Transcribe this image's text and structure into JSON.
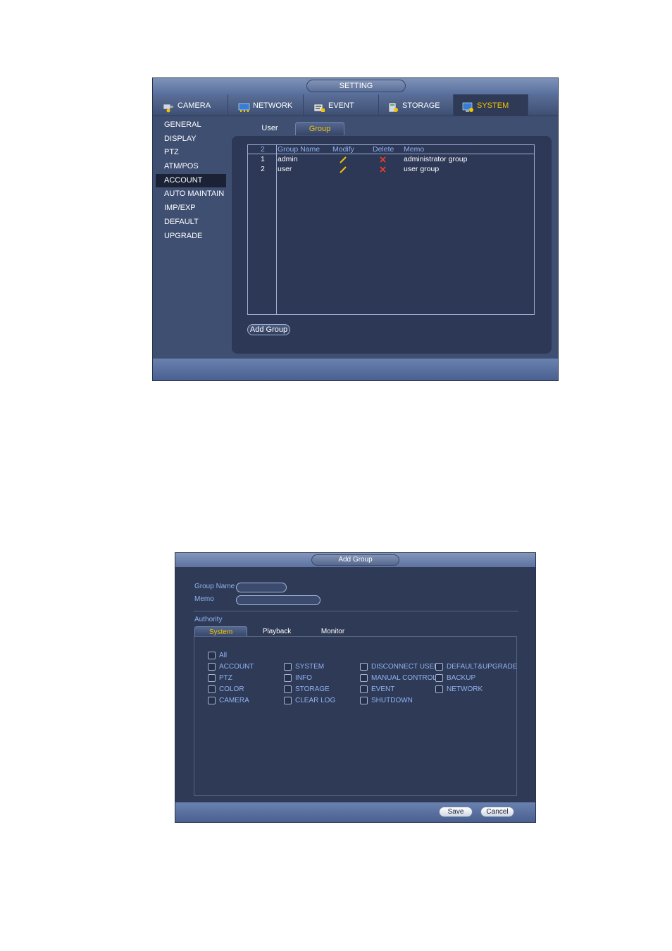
{
  "setting": {
    "title": "SETTING",
    "tabs": [
      {
        "label": "CAMERA",
        "icon": "camera-icon"
      },
      {
        "label": "NETWORK",
        "icon": "network-icon"
      },
      {
        "label": "EVENT",
        "icon": "event-icon"
      },
      {
        "label": "STORAGE",
        "icon": "storage-icon"
      },
      {
        "label": "SYSTEM",
        "icon": "system-icon",
        "active": true
      }
    ],
    "sidebar": [
      "GENERAL",
      "DISPLAY",
      "PTZ",
      "ATM/POS",
      "ACCOUNT",
      "AUTO MAINTAIN",
      "IMP/EXP",
      "DEFAULT",
      "UPGRADE"
    ],
    "sidebar_active": "ACCOUNT",
    "subtabs": {
      "user": "User",
      "group": "Group"
    },
    "table": {
      "count": "2",
      "headers": {
        "name": "Group Name",
        "modify": "Modify",
        "delete": "Delete",
        "memo": "Memo"
      },
      "rows": [
        {
          "index": "1",
          "name": "admin",
          "memo": "administrator group"
        },
        {
          "index": "2",
          "name": "user",
          "memo": "user group"
        }
      ]
    },
    "add_group_label": "Add Group"
  },
  "add_group": {
    "title": "Add Group",
    "group_name_label": "Group Name",
    "memo_label": "Memo",
    "authority_label": "Authority",
    "tabs": {
      "system": "System",
      "playback": "Playback",
      "monitor": "Monitor"
    },
    "checkboxes": {
      "all": "All",
      "account": "ACCOUNT",
      "ptz": "PTZ",
      "color": "COLOR",
      "camera": "CAMERA",
      "system": "SYSTEM",
      "info": "INFO",
      "storage": "STORAGE",
      "clear_log": "CLEAR LOG",
      "disconnect_user": "DISCONNECT USER",
      "manual_control": "MANUAL CONTROL",
      "event": "EVENT",
      "shutdown": "SHUTDOWN",
      "default_upgrade": "DEFAULT&UPGRADE",
      "backup": "BACKUP",
      "network": "NETWORK"
    },
    "save_label": "Save",
    "cancel_label": "Cancel"
  },
  "colors": {
    "accent": "#f5c400",
    "label_blue": "#8fb2f0",
    "panel": "#2d3756",
    "delete_red": "#e8402a"
  }
}
